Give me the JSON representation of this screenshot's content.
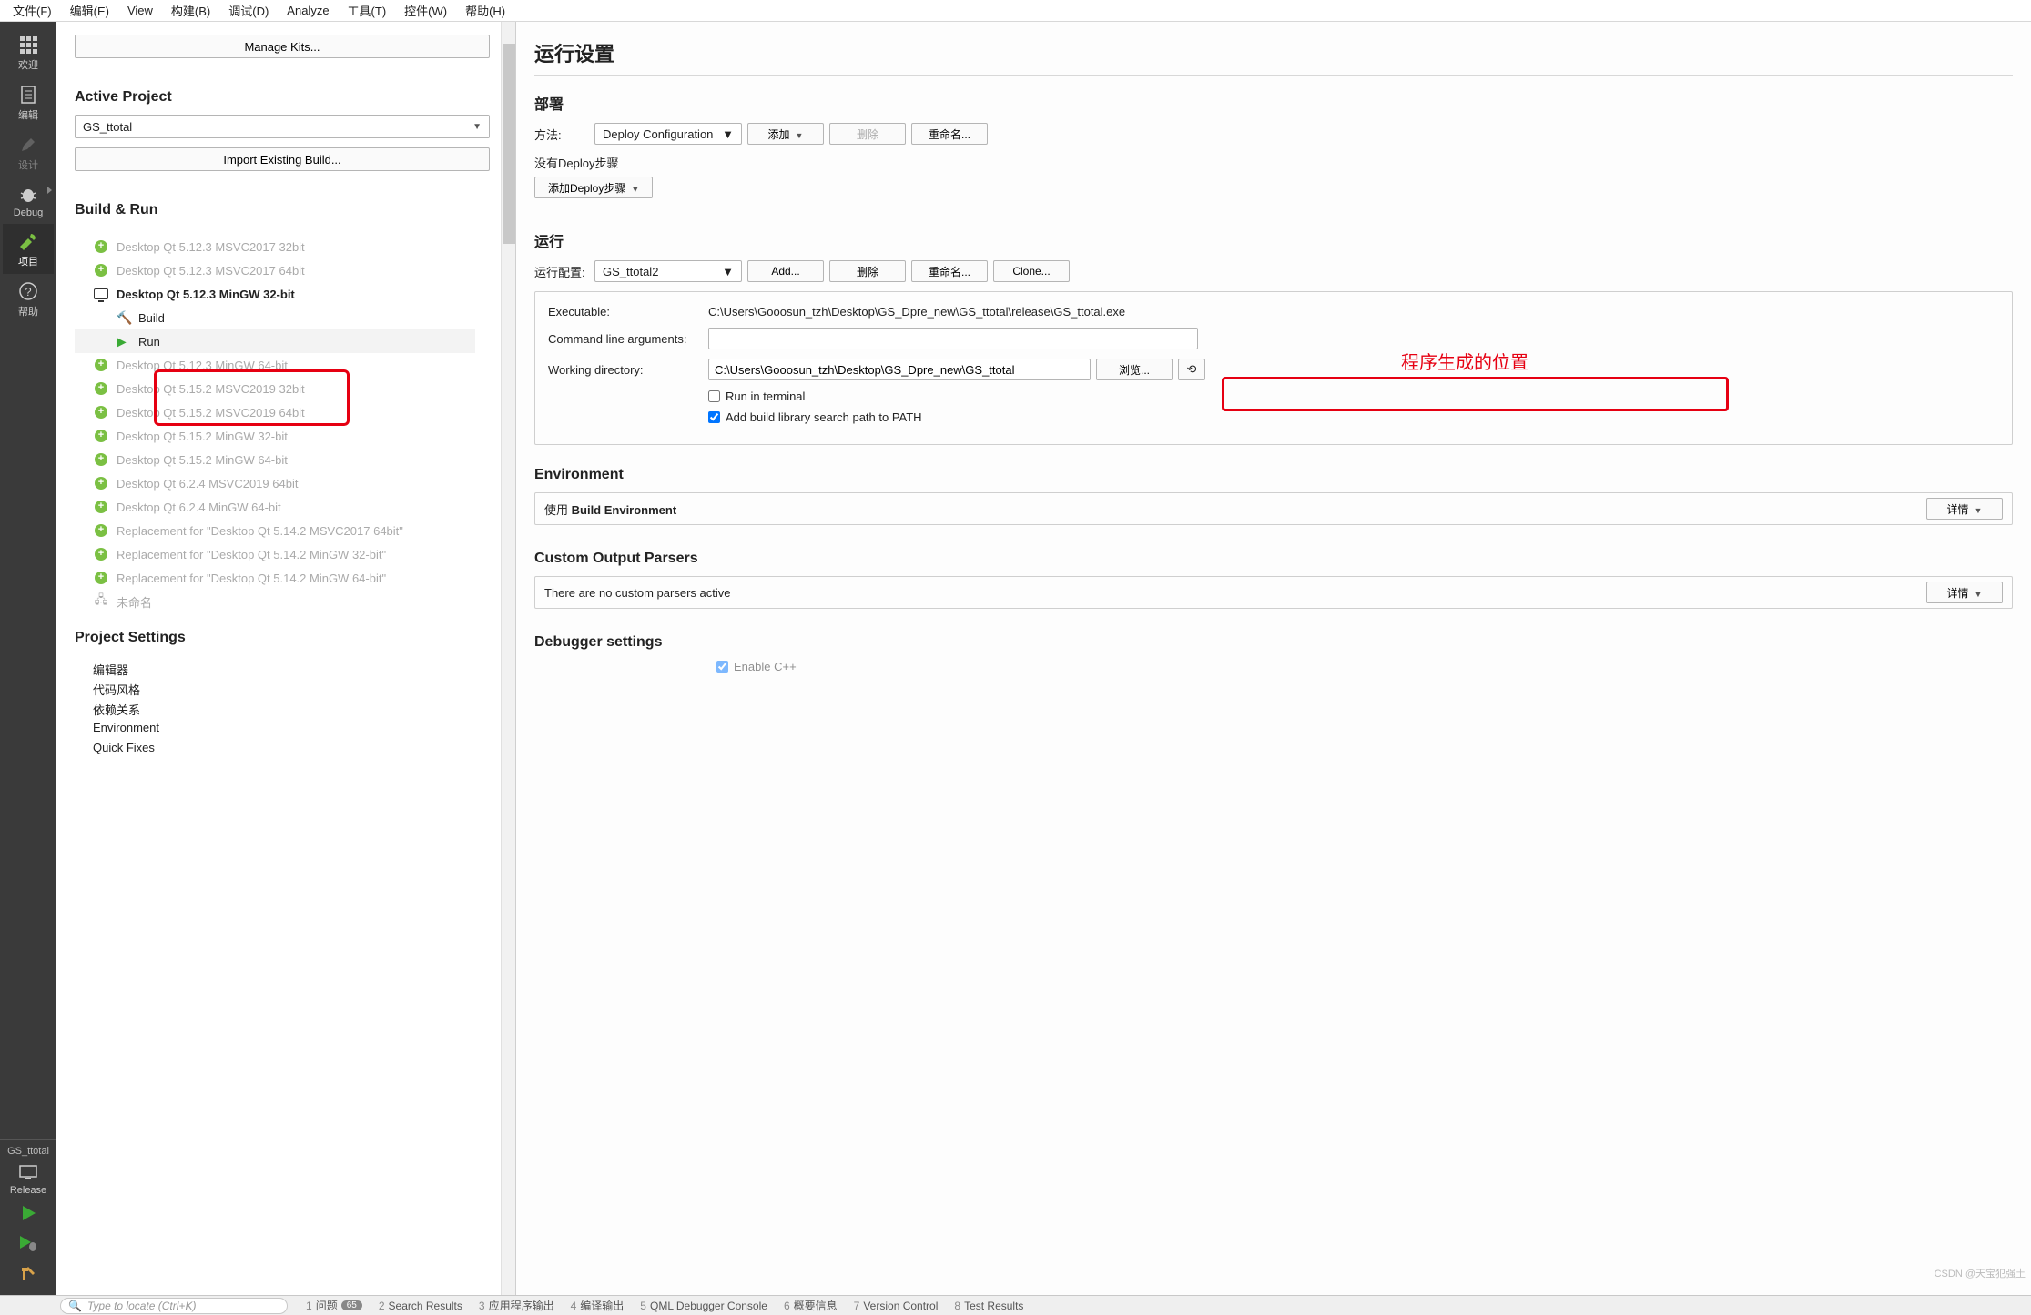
{
  "menubar": [
    "文件(F)",
    "编辑(E)",
    "View",
    "构建(B)",
    "调试(D)",
    "Analyze",
    "工具(T)",
    "控件(W)",
    "帮助(H)"
  ],
  "sidebar": {
    "items": [
      {
        "label": "欢迎",
        "icon": "grid"
      },
      {
        "label": "编辑",
        "icon": "doc"
      },
      {
        "label": "设计",
        "icon": "pencil"
      },
      {
        "label": "Debug",
        "icon": "bug"
      },
      {
        "label": "项目",
        "icon": "wrench"
      },
      {
        "label": "帮助",
        "icon": "question"
      }
    ],
    "target_project": "GS_ttotal",
    "target_config": "Release"
  },
  "projectPanel": {
    "manage_kits": "Manage Kits...",
    "active_project_h": "Active Project",
    "active_project": "GS_ttotal",
    "import_build": "Import Existing Build...",
    "build_run_h": "Build & Run",
    "kits": [
      {
        "label": "Desktop Qt 5.12.3 MSVC2017 32bit",
        "dim": true,
        "icon": "plus"
      },
      {
        "label": "Desktop Qt 5.12.3 MSVC2017 64bit",
        "dim": true,
        "icon": "plus"
      },
      {
        "label": "Desktop Qt 5.12.3 MinGW 32-bit",
        "dim": false,
        "icon": "monitor",
        "bold": true,
        "expanded": true
      },
      {
        "label": "Desktop Qt 5.12.3 MinGW 64-bit",
        "dim": true,
        "icon": "plus"
      },
      {
        "label": "Desktop Qt 5.15.2 MSVC2019 32bit",
        "dim": true,
        "icon": "plus"
      },
      {
        "label": "Desktop Qt 5.15.2 MSVC2019 64bit",
        "dim": true,
        "icon": "plus"
      },
      {
        "label": "Desktop Qt 5.15.2 MinGW 32-bit",
        "dim": true,
        "icon": "plus"
      },
      {
        "label": "Desktop Qt 5.15.2 MinGW 64-bit",
        "dim": true,
        "icon": "plus"
      },
      {
        "label": "Desktop Qt 6.2.4 MSVC2019 64bit",
        "dim": true,
        "icon": "plus"
      },
      {
        "label": "Desktop Qt 6.2.4 MinGW 64-bit",
        "dim": true,
        "icon": "plus"
      },
      {
        "label": "Replacement for \"Desktop Qt 5.14.2 MSVC2017 64bit\"",
        "dim": true,
        "icon": "plus"
      },
      {
        "label": "Replacement for \"Desktop Qt 5.14.2 MinGW 32-bit\"",
        "dim": true,
        "icon": "plus"
      },
      {
        "label": "Replacement for \"Desktop Qt 5.14.2 MinGW 64-bit\"",
        "dim": true,
        "icon": "plus"
      },
      {
        "label": "未命名",
        "dim": true,
        "icon": "server"
      }
    ],
    "sub_build": "Build",
    "sub_run": "Run",
    "project_settings_h": "Project Settings",
    "project_settings": [
      "编辑器",
      "代码风格",
      "依赖关系",
      "Environment",
      "Quick Fixes"
    ]
  },
  "content": {
    "title": "运行设置",
    "deploy_h": "部署",
    "method_lbl": "方法:",
    "deploy_cfg": "Deploy Configuration",
    "add_btn": "添加",
    "delete_btn": "删除",
    "rename_btn": "重命名...",
    "no_deploy": "没有Deploy步骤",
    "add_deploy": "添加Deploy步骤",
    "run_h": "运行",
    "run_cfg_lbl": "运行配置:",
    "run_cfg_val": "GS_ttotal2",
    "add2": "Add...",
    "delete2": "删除",
    "rename2": "重命名...",
    "clone": "Clone...",
    "annotation": "程序生成的位置",
    "exe_lbl": "Executable:",
    "exe_val": "C:\\Users\\Gooosun_tzh\\Desktop\\GS_Dpre_new\\GS_ttotal\\release\\GS_ttotal.exe",
    "args_lbl": "Command line arguments:",
    "args_val": "",
    "wd_lbl": "Working directory:",
    "wd_val": "C:\\Users\\Gooosun_tzh\\Desktop\\GS_Dpre_new\\GS_ttotal",
    "browse": "浏览...",
    "run_terminal": "Run in terminal",
    "add_path": "Add build library search path to PATH",
    "env_h": "Environment",
    "env_detail": "使用 Build Environment",
    "env_detail_strong": "Build Environment",
    "detail_btn": "详情",
    "parsers_h": "Custom Output Parsers",
    "parsers_detail": "There are no custom parsers active",
    "debugger_h": "Debugger settings",
    "enable_cpp": "Enable C++"
  },
  "bottombar": {
    "search_placeholder": "Type to locate (Ctrl+K)",
    "tabs": [
      {
        "num": "1",
        "label": "问题",
        "badge": "65"
      },
      {
        "num": "2",
        "label": "Search Results"
      },
      {
        "num": "3",
        "label": "应用程序输出"
      },
      {
        "num": "4",
        "label": "编译输出"
      },
      {
        "num": "5",
        "label": "QML Debugger Console"
      },
      {
        "num": "6",
        "label": "概要信息"
      },
      {
        "num": "7",
        "label": "Version Control"
      },
      {
        "num": "8",
        "label": "Test Results"
      }
    ]
  },
  "watermark": "CSDN @天宝犯强土"
}
